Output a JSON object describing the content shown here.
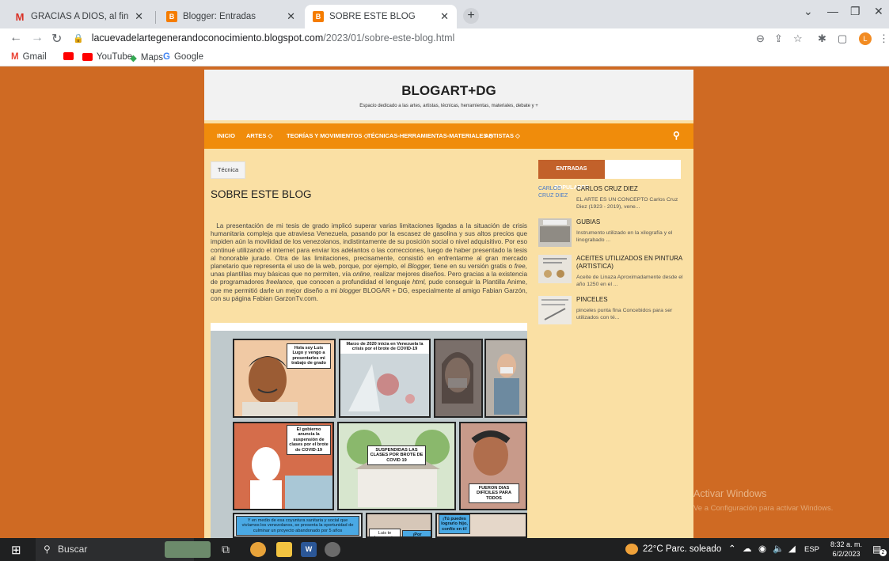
{
  "browser": {
    "tabs": [
      {
        "title": "GRACIAS A DIOS, al fin TDG LEL",
        "favicon_color": "#d93025"
      },
      {
        "title": "Blogger: Entradas",
        "favicon_color": "#f57c00"
      },
      {
        "title": "SOBRE ESTE BLOG",
        "favicon_color": "#f57c00"
      }
    ],
    "url_host": "lacuevadelartegenerandoconocimiento.blogspot.com",
    "url_path": "/2023/01/sobre-este-blog.html",
    "profile_initial": "L",
    "bookmarks": [
      {
        "label": "Gmail",
        "color": "#ea4335"
      },
      {
        "label": "",
        "color": "#ff0000"
      },
      {
        "label": "YouTube",
        "color": "#ff0000"
      },
      {
        "label": "Maps",
        "color": "#34a853"
      },
      {
        "label": "Google",
        "color": "#4285f4"
      }
    ]
  },
  "blog": {
    "title": "BLOGART+DG",
    "description": "Espacio dedicado a las artes, artistas, técnicas, herramientas, materiales, debate y +",
    "nav": [
      "INICIO",
      "ARTES ◇",
      "TEORÍAS Y MOVIMIENTOS ◇",
      "TÉCNICAS-HERRAMIENTAS-MATERIALES ◇",
      "ARTISTAS ◇"
    ],
    "post": {
      "tag": "Técnica",
      "title": "SOBRE ESTE BLOG",
      "body_1": "La presentación de mi tesis de grado implicó superar varias limitaciones ligadas a la situación de crisis humanitaria compleja que atraviesa Venezuela, pasando por la escasez de gasolina y sus altos precios que impiden aún la movilidad de los venezolanos, indistintamente de su posición social o nivel adquisitivo. Por eso continué utilizando el internet para enviar los adelantos o las correcciones, luego de haber presentado la tesis al honorable jurado. Otra de las limitaciones, precisamente, consistió en enfrentarme al gran mercado planetario que representa el uso de la web, porque, por ejemplo, el ",
      "body_blogger": "Blogger,",
      "body_2": " tiene en su versión gratis o ",
      "body_free": "free,",
      "body_3": " unas plantillas muy básicas que no permiten, vía ",
      "body_online": "online,",
      "body_4": " realizar mejores diseños. Pero gracias a la existencia de programadores ",
      "body_freelance": "freelance,",
      "body_5": " que conocen a profundidad el lenguaje ",
      "body_html": "html,",
      "body_6": " pude conseguir la Plantilla Anime, que me permitió darle un mejor diseño a mi ",
      "body_blogger2": "blogger",
      "body_7": " BLOGAR + DG, especialmente al amigo Fabian Garzón, con su página Fabian GarzonTv.com.",
      "comic_bubbles": [
        "Hola soy Luis Lugo y vengo a presentarles mi trabajo de grado",
        "Marzo de 2020 inicia en Venezuela la crisis por el brote de COVID-19",
        "El gobierno anuncia la suspensión de clases por el brote de COVID-19",
        "SUSPENDIDAS LAS CLASES POR BROTE DE COVID 19",
        "FUERON DIAS DIFÍCILES PARA TODOS",
        "Y en medio de esa coyuntura sanitaria y social que vivíamos los venezolanos, se presenta la oportunidad de culminar un proyecto abandonado por 5 años",
        "¡Tú puedes lograrlo hijo, confío en ti!",
        "¡Por supuesto",
        "Luis te levamento terminar tu trabajo"
      ]
    },
    "sidebar": {
      "heading": "ENTRADAS POPULARES",
      "items": [
        {
          "alt": "CARLOS CRUZ DIEZ",
          "title": "CARLOS CRUZ DIEZ",
          "desc": "EL ARTE ES UN CONCEPTO Carlos Cruz Diez (1923 - 2019), vene..."
        },
        {
          "title": "GUBIAS",
          "desc": "Instrumento utilizado en la xilografía y el linograbado ..."
        },
        {
          "title": "ACEITES UTILIZADOS EN PINTURA (ARTISTICA)",
          "desc": "Aceite de Linaza Aproximadamente desde el año 1250 en el ..."
        },
        {
          "title": "PINCELES",
          "desc": "pinceles punta fina Concebidos para ser utilizados con té..."
        }
      ]
    }
  },
  "watermark": {
    "line1": "Activar Windows",
    "line2": "Ve a Configuración para activar Windows."
  },
  "taskbar": {
    "search_label": "Buscar",
    "weather": "22°C  Parc. soleado",
    "lang": "ESP",
    "time": "8:32 a. m.",
    "date": "6/2/2023",
    "notif_count": "2"
  }
}
